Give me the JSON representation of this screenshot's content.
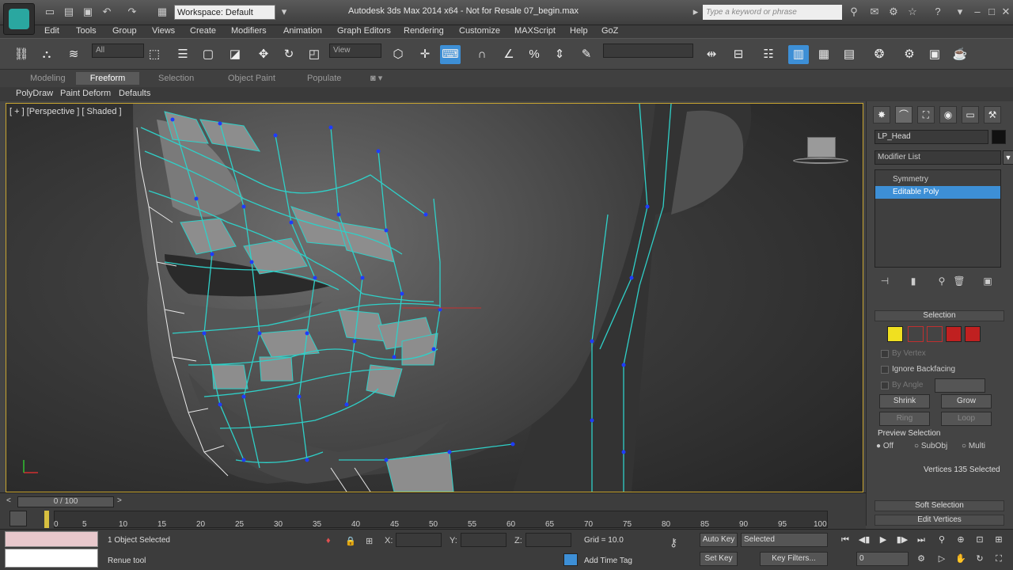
{
  "title_bar": {
    "workspace": "Workspace: Default",
    "window_title": "Autodesk 3ds Max 2014 x64    -  Not for Resale   07_begin.max",
    "search_placeholder": "Type a keyword or phrase"
  },
  "menu": [
    "Edit",
    "Tools",
    "Group",
    "Views",
    "Create",
    "Modifiers",
    "Animation",
    "Graph Editors",
    "Rendering",
    "Customize",
    "MAXScript",
    "Help",
    "GoZ"
  ],
  "main_toolbar": {
    "selection_filter": "All",
    "reference_coord": "View"
  },
  "ribbon": {
    "tabs": [
      "Modeling",
      "Freeform",
      "Selection",
      "Object Paint",
      "Populate"
    ],
    "active_tab": "Freeform",
    "subtabs": [
      "PolyDraw",
      "Paint Deform",
      "Defaults"
    ]
  },
  "viewport": {
    "label": "[ + ] [Perspective ] [ Shaded ]"
  },
  "command_panel": {
    "object_name": "LP_Head",
    "modifier_list": "Modifier List",
    "stack": [
      "Symmetry",
      "Editable Poly"
    ],
    "selected_stack_index": 1,
    "rollout_selection": "Selection",
    "options": [
      "By Vertex",
      "Ignore Backfacing",
      "By Angle"
    ],
    "shrink": "Shrink",
    "grow": "Grow",
    "ring": "Ring",
    "loop": "Loop",
    "preview_selection": "Preview Selection",
    "preview_options": [
      "Off",
      "SubObj",
      "Multi"
    ],
    "status": "Vertices 135 Selected",
    "soft_selection": "Soft Selection",
    "edit_vertices": "Edit Vertices"
  },
  "timeline": {
    "frame": "0 / 100",
    "ticks": [
      "0",
      "5",
      "10",
      "15",
      "20",
      "25",
      "30",
      "35",
      "40",
      "45",
      "50",
      "55",
      "60",
      "65",
      "70",
      "75",
      "80",
      "85",
      "90",
      "95",
      "100"
    ]
  },
  "status_bar": {
    "objects_selected": "1 Object Selected",
    "prompt": "Renue tool",
    "x_label": "X:",
    "y_label": "Y:",
    "z_label": "Z:",
    "grid": "Grid = 10.0",
    "auto_key": "Auto Key",
    "set_key": "Set Key",
    "key_mode": "Selected",
    "key_filters": "Key Filters...",
    "add_time_tag": "Add Time Tag",
    "current_frame": "0"
  }
}
